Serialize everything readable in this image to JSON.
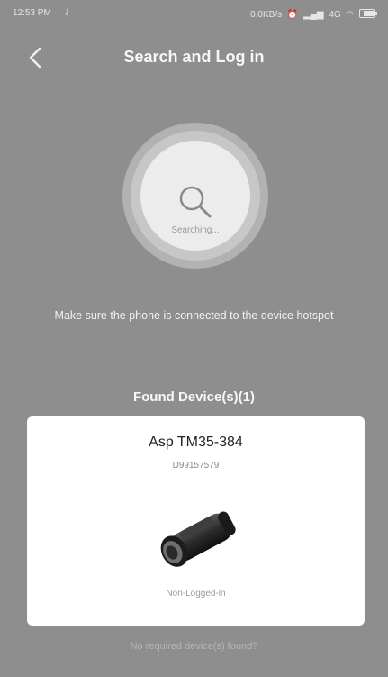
{
  "status_bar": {
    "time": "12:53 PM",
    "usb_icon": "usb-icon",
    "network_speed": "0.0KB/s",
    "network_type": "4G",
    "icons": [
      "alarm-icon",
      "signal-icon",
      "wifi-icon",
      "battery-icon"
    ],
    "battery_level": 0.75
  },
  "header": {
    "title": "Search and Log in",
    "back_icon": "chevron-left-icon"
  },
  "search": {
    "icon": "search-icon",
    "status_text": "Searching..."
  },
  "hint": "Make sure the phone is connected to the device hotspot",
  "found": {
    "title": "Found Device(s)(1)"
  },
  "device": {
    "name": "Asp TM35-384",
    "serial": "D99157579",
    "image": "thermal-monocular-image",
    "status": "Non-Logged-in"
  },
  "footer": {
    "no_device_text": "No required device(s) found?"
  },
  "colors": {
    "background": "#8e8e8e",
    "card": "#ffffff",
    "search_circle": "#ececec"
  }
}
